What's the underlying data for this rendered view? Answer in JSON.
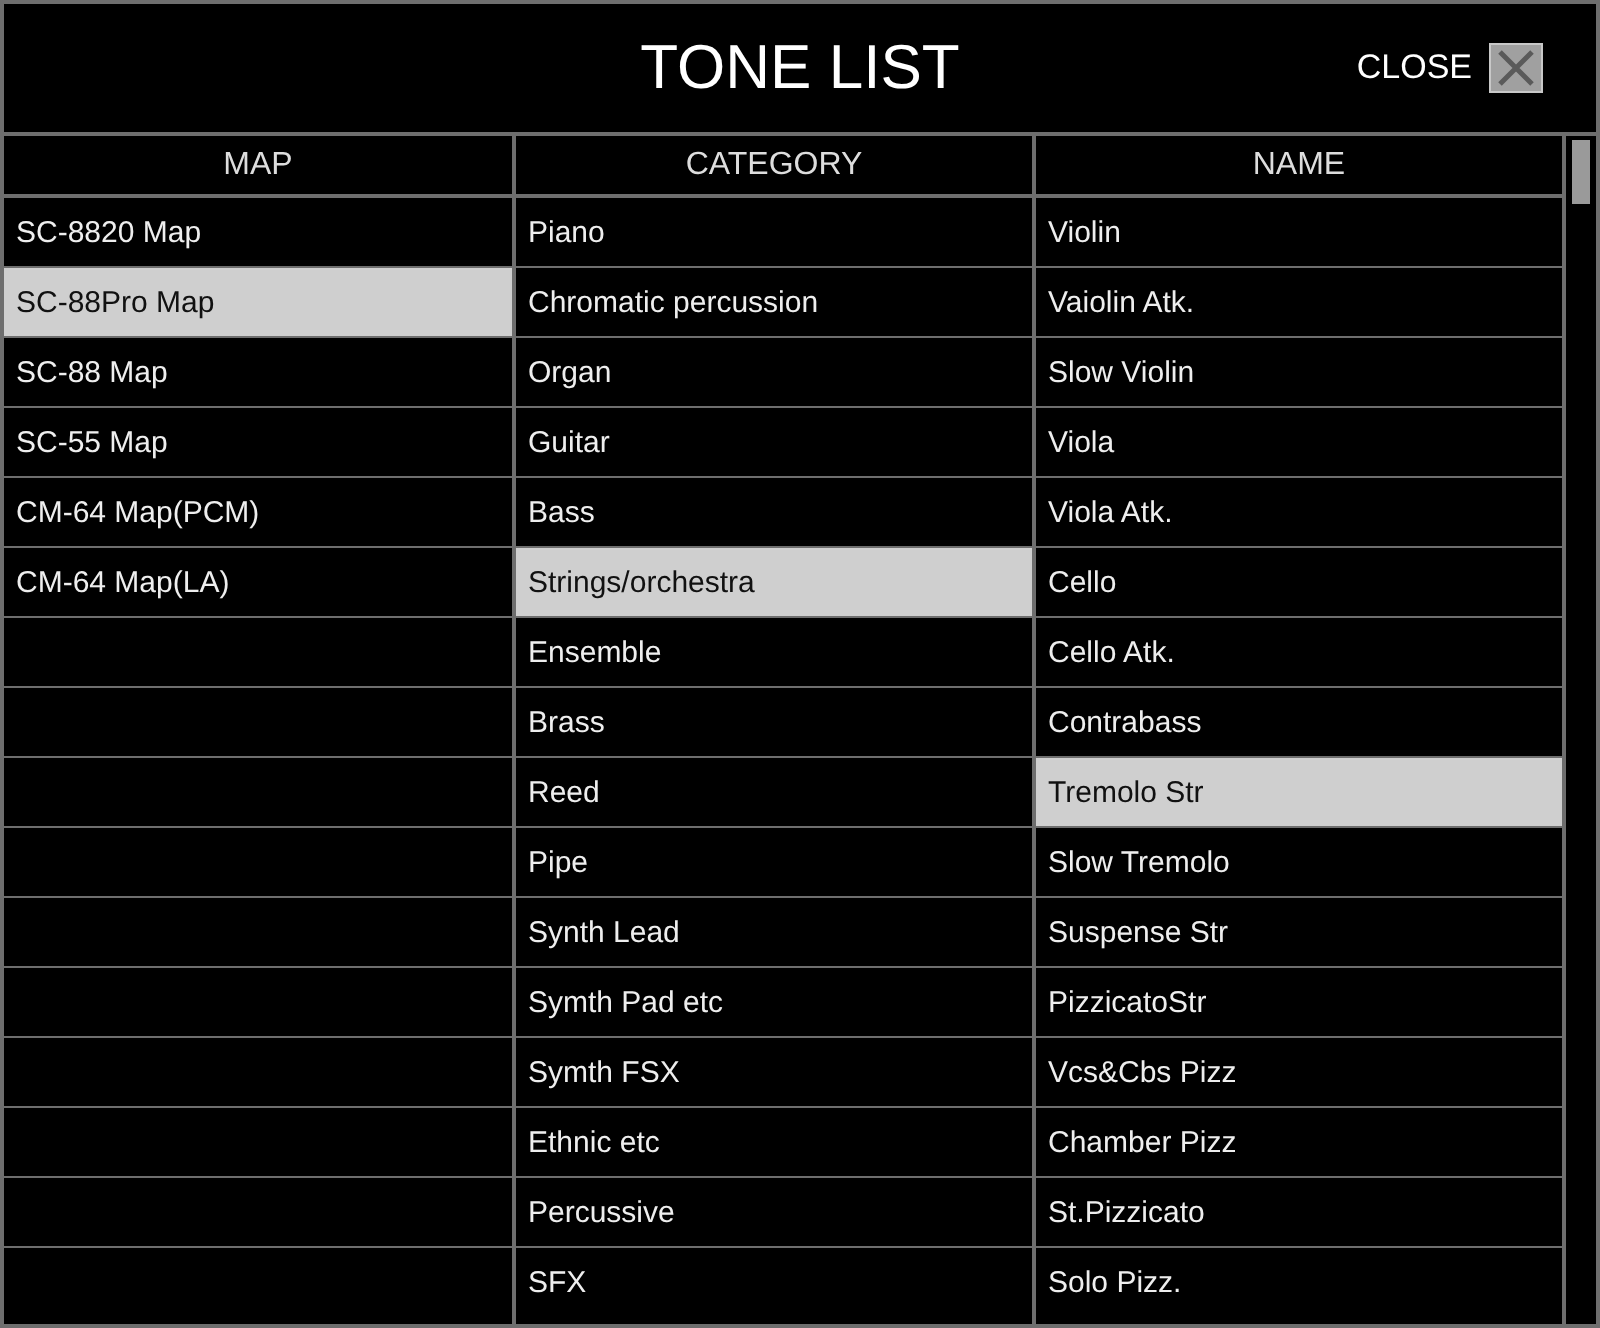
{
  "window": {
    "title": "TONE LIST",
    "close_label": "CLOSE"
  },
  "columns": [
    {
      "heading": "MAP",
      "items": [
        {
          "label": "SC-8820 Map",
          "selected": false
        },
        {
          "label": "SC-88Pro Map",
          "selected": true
        },
        {
          "label": "SC-88 Map",
          "selected": false
        },
        {
          "label": "SC-55 Map",
          "selected": false
        },
        {
          "label": "CM-64 Map(PCM)",
          "selected": false
        },
        {
          "label": "CM-64 Map(LA)",
          "selected": false
        }
      ]
    },
    {
      "heading": "CATEGORY",
      "items": [
        {
          "label": "Piano",
          "selected": false
        },
        {
          "label": "Chromatic percussion",
          "selected": false
        },
        {
          "label": "Organ",
          "selected": false
        },
        {
          "label": "Guitar",
          "selected": false
        },
        {
          "label": "Bass",
          "selected": false
        },
        {
          "label": "Strings/orchestra",
          "selected": true
        },
        {
          "label": "Ensemble",
          "selected": false
        },
        {
          "label": "Brass",
          "selected": false
        },
        {
          "label": "Reed",
          "selected": false
        },
        {
          "label": "Pipe",
          "selected": false
        },
        {
          "label": "Synth Lead",
          "selected": false
        },
        {
          "label": "Symth Pad etc",
          "selected": false
        },
        {
          "label": "Symth FSX",
          "selected": false
        },
        {
          "label": "Ethnic etc",
          "selected": false
        },
        {
          "label": "Percussive",
          "selected": false
        },
        {
          "label": "SFX",
          "selected": false
        }
      ]
    },
    {
      "heading": "NAME",
      "items": [
        {
          "label": "Violin",
          "selected": false
        },
        {
          "label": "Vaiolin Atk.",
          "selected": false
        },
        {
          "label": "Slow Violin",
          "selected": false
        },
        {
          "label": "Viola",
          "selected": false
        },
        {
          "label": "Viola Atk.",
          "selected": false
        },
        {
          "label": "Cello",
          "selected": false
        },
        {
          "label": "Cello Atk.",
          "selected": false
        },
        {
          "label": "Contrabass",
          "selected": false
        },
        {
          "label": "Tremolo Str",
          "selected": true
        },
        {
          "label": "Slow Tremolo",
          "selected": false
        },
        {
          "label": "Suspense Str",
          "selected": false
        },
        {
          "label": "PizzicatoStr",
          "selected": false
        },
        {
          "label": "Vcs&Cbs Pizz",
          "selected": false
        },
        {
          "label": "Chamber Pizz",
          "selected": false
        },
        {
          "label": "St.Pizzicato",
          "selected": false
        },
        {
          "label": "Solo Pizz.",
          "selected": false
        }
      ]
    }
  ]
}
